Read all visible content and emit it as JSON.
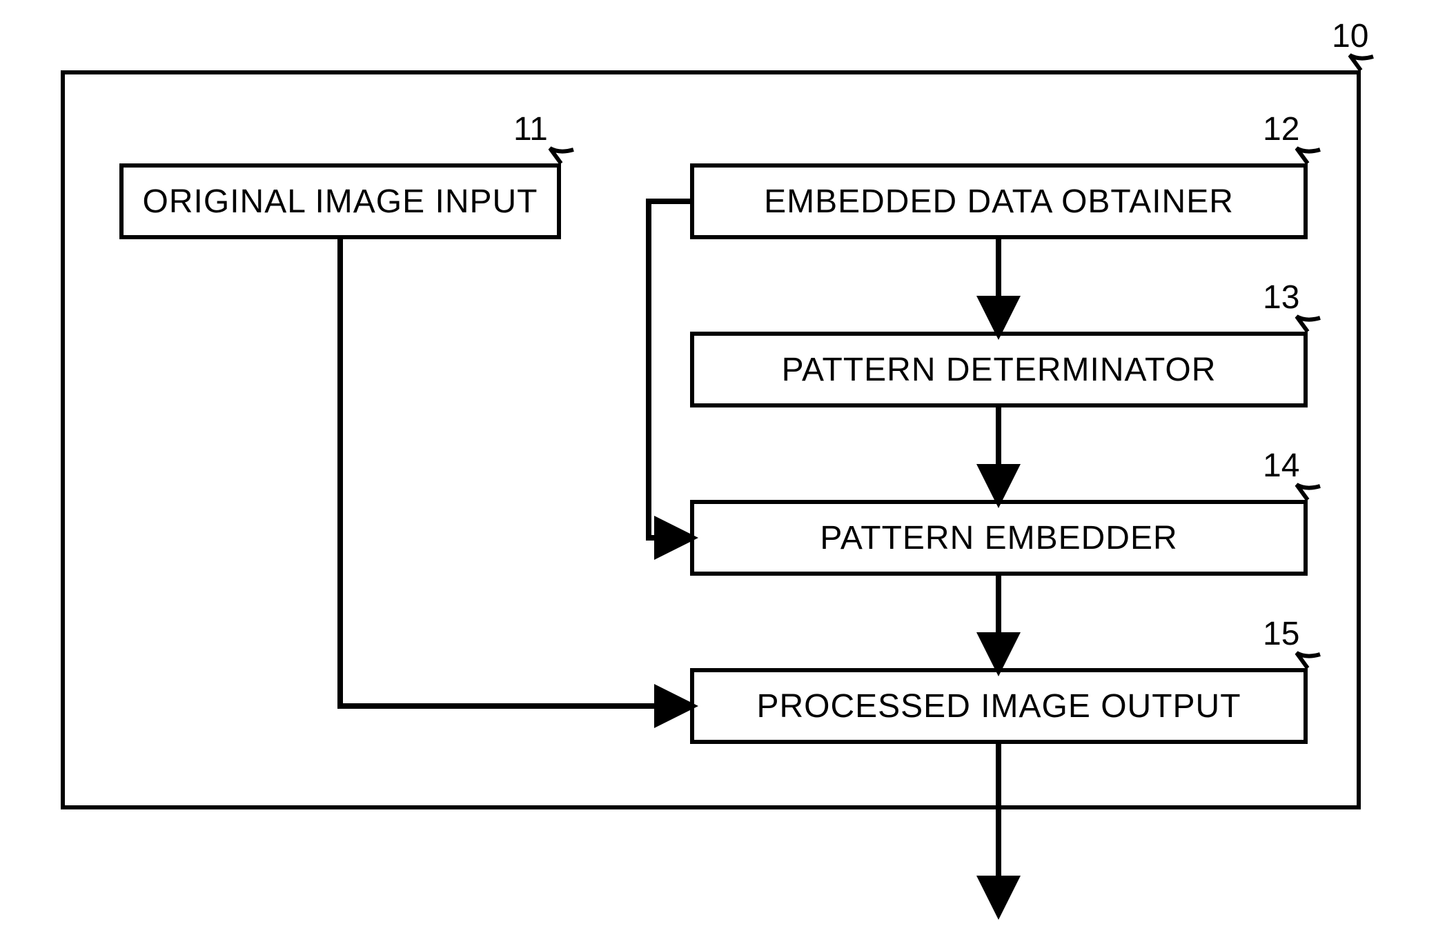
{
  "diagram": {
    "container_ref": "10",
    "blocks": {
      "original_image_input": {
        "label": "ORIGINAL IMAGE INPUT",
        "ref": "11"
      },
      "embedded_data_obtainer": {
        "label": "EMBEDDED DATA OBTAINER",
        "ref": "12"
      },
      "pattern_determinator": {
        "label": "PATTERN DETERMINATOR",
        "ref": "13"
      },
      "pattern_embedder": {
        "label": "PATTERN EMBEDDER",
        "ref": "14"
      },
      "processed_image_output": {
        "label": "PROCESSED IMAGE OUTPUT",
        "ref": "15"
      }
    },
    "flows": [
      {
        "from": "original_image_input",
        "to": "processed_image_output"
      },
      {
        "from": "embedded_data_obtainer",
        "to": "pattern_determinator"
      },
      {
        "from": "pattern_determinator",
        "to": "pattern_embedder"
      },
      {
        "from": "embedded_data_obtainer",
        "to": "pattern_embedder"
      },
      {
        "from": "pattern_embedder",
        "to": "processed_image_output"
      },
      {
        "from": "processed_image_output",
        "to": "external_output"
      }
    ]
  }
}
